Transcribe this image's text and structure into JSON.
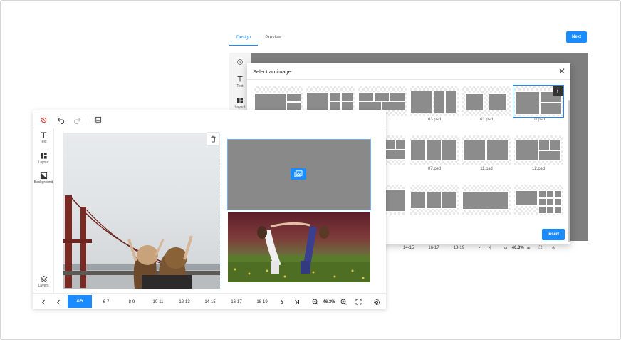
{
  "back_window": {
    "tabs": [
      {
        "label": "Design",
        "active": true
      },
      {
        "label": "Preview",
        "active": false
      }
    ],
    "next_label": "Next",
    "sidebar": [
      {
        "label": "",
        "icon": "history-icon"
      },
      {
        "label": "Text",
        "icon": "text-icon"
      },
      {
        "label": "Layout",
        "icon": "layout-icon"
      }
    ],
    "bottom_pages": [
      "14-15",
      "16-17",
      "18-19"
    ],
    "zoom": "46.3%"
  },
  "modal": {
    "title": "Select an image",
    "insert_label": "Insert",
    "thumbnails": [
      {
        "label": "",
        "selected": false
      },
      {
        "label": "",
        "selected": false
      },
      {
        "label": "d",
        "selected": false
      },
      {
        "label": "03.psd",
        "selected": false
      },
      {
        "label": "01.psd",
        "selected": false
      },
      {
        "label": "10.psd",
        "selected": true
      },
      {
        "label": "d",
        "selected": false
      },
      {
        "label": "07.psd",
        "selected": false
      },
      {
        "label": "11.psd",
        "selected": false
      },
      {
        "label": "12.psd",
        "selected": false
      },
      {
        "label": "",
        "selected": false
      },
      {
        "label": "",
        "selected": false
      },
      {
        "label": "",
        "selected": false
      },
      {
        "label": "",
        "selected": false
      }
    ]
  },
  "editor": {
    "toolbar_icons": [
      "history-icon",
      "undo-icon",
      "redo-icon",
      "add-image-icon"
    ],
    "sidebar": [
      {
        "label": "Text",
        "icon": "text-icon"
      },
      {
        "label": "Layout",
        "icon": "layout-icon"
      },
      {
        "label": "Background",
        "icon": "background-icon"
      },
      {
        "label": "Layers",
        "icon": "layers-icon"
      }
    ],
    "pages": [
      {
        "label": "4-5",
        "active": true
      },
      {
        "label": "6-7",
        "active": false
      },
      {
        "label": "8-9",
        "active": false
      },
      {
        "label": "10-11",
        "active": false
      },
      {
        "label": "12-13",
        "active": false
      },
      {
        "label": "14-15",
        "active": false
      },
      {
        "label": "16-17",
        "active": false
      },
      {
        "label": "18-19",
        "active": false
      }
    ],
    "zoom": "46.3%"
  },
  "colors": {
    "accent": "#1a8cff",
    "placeholder_gray": "#898989",
    "history_icon": "#e0413a"
  }
}
